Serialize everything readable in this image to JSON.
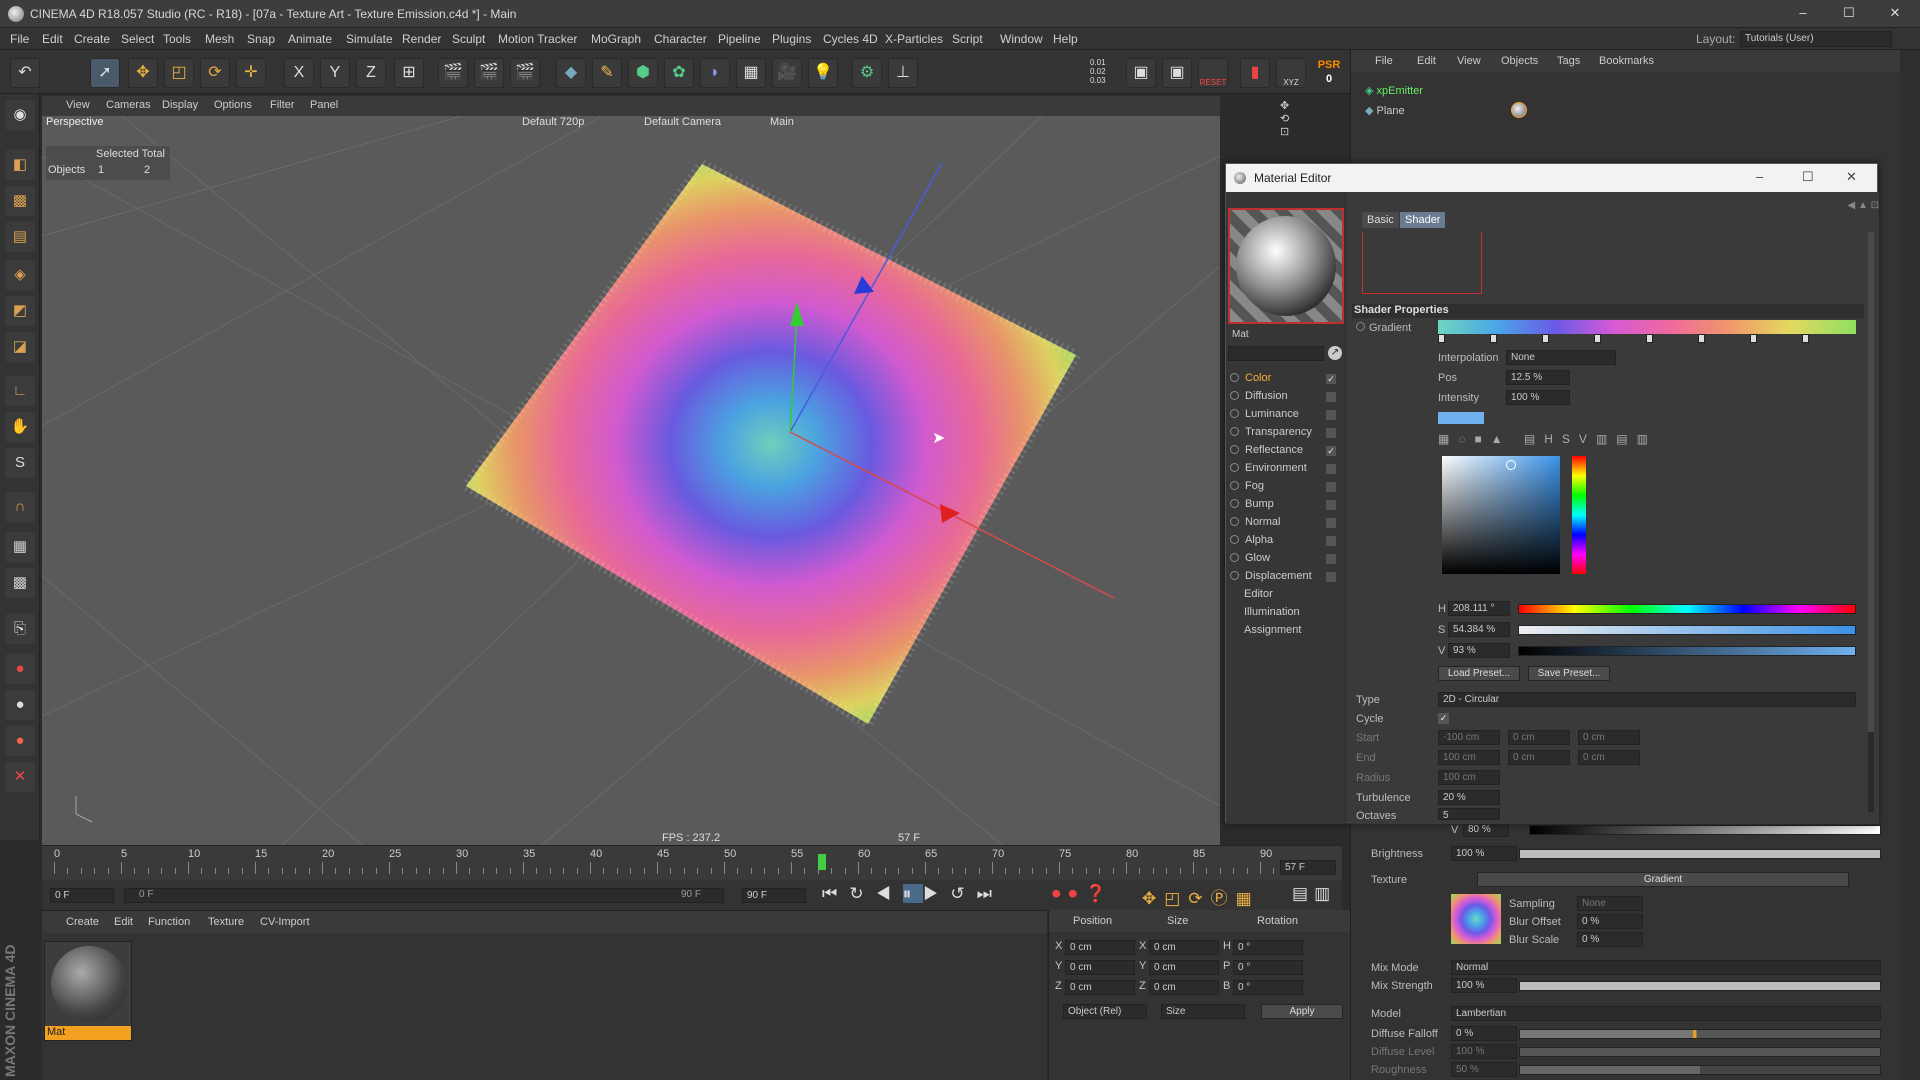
{
  "window": {
    "title": "CINEMA 4D R18.057 Studio (RC - R18) - [07a - Texture Art - Texture Emission.c4d *] - Main",
    "min": "–",
    "max": "☐",
    "close": "✕"
  },
  "menu": [
    "File",
    "Edit",
    "Create",
    "Select",
    "Tools",
    "Mesh",
    "Snap",
    "Animate",
    "Simulate",
    "Render",
    "Sculpt",
    "Motion Tracker",
    "MoGraph",
    "Character",
    "Pipeline",
    "Plugins",
    "Cycles 4D",
    "X-Particles",
    "Script",
    "Window",
    "Help"
  ],
  "layout": {
    "label": "Layout:",
    "value": "Tutorials (User)"
  },
  "toolbar": {
    "axis_x": "X",
    "axis_y": "Y",
    "axis_z": "Z",
    "reset": "RESET",
    "psr": "PSR",
    "psr_val": "0",
    "xyz": "XYZ",
    "coords": [
      "0.01",
      "0.02",
      "0.03"
    ]
  },
  "viewport": {
    "menu": [
      "View",
      "Cameras",
      "Display",
      "Options",
      "Filter",
      "Panel"
    ],
    "label": "Perspective",
    "res": "Default 720p",
    "cam": "Default Camera",
    "take": "Main",
    "fps": "FPS : 237.2",
    "frame": "57 F",
    "info": {
      "header": "Selected Total",
      "row_label": "Objects",
      "selected": "1",
      "total": "2"
    }
  },
  "timeline": {
    "ticks": [
      "0",
      "5",
      "10",
      "15",
      "20",
      "25",
      "30",
      "35",
      "40",
      "45",
      "50",
      "55",
      "60",
      "65",
      "70",
      "75",
      "80",
      "85",
      "90"
    ],
    "current": "57 F",
    "start": "0 F",
    "range_start": "0 F",
    "range_end": "90 F",
    "end": "90 F"
  },
  "materials": {
    "menu": [
      "Create",
      "Edit",
      "Function",
      "Texture",
      "CV-Import"
    ],
    "mat_name": "Mat"
  },
  "coords": {
    "headers": [
      "Position",
      "Size",
      "Rotation"
    ],
    "rows": [
      {
        "a": "X",
        "pos": "0 cm",
        "b": "X",
        "size": "0 cm",
        "c": "H",
        "rot": "0 °"
      },
      {
        "a": "Y",
        "pos": "0 cm",
        "b": "Y",
        "size": "0 cm",
        "c": "P",
        "rot": "0 °"
      },
      {
        "a": "Z",
        "pos": "0 cm",
        "b": "Z",
        "size": "0 cm",
        "c": "B",
        "rot": "0 °"
      }
    ],
    "mode": "Object (Rel)",
    "size_mode": "Size",
    "apply": "Apply"
  },
  "objmanager": {
    "menu": [
      "File",
      "Edit",
      "View",
      "Objects",
      "Tags",
      "Bookmarks"
    ],
    "objects": [
      "xpEmitter",
      "Plane"
    ]
  },
  "mateditor": {
    "title": "Material Editor",
    "mat_name": "Mat",
    "channels": [
      {
        "name": "Color",
        "checked": true,
        "active": true
      },
      {
        "name": "Diffusion",
        "checked": false
      },
      {
        "name": "Luminance",
        "checked": false
      },
      {
        "name": "Transparency",
        "checked": false
      },
      {
        "name": "Reflectance",
        "checked": true
      },
      {
        "name": "Environment",
        "checked": false
      },
      {
        "name": "Fog",
        "checked": false
      },
      {
        "name": "Bump",
        "checked": false
      },
      {
        "name": "Normal",
        "checked": false
      },
      {
        "name": "Alpha",
        "checked": false
      },
      {
        "name": "Glow",
        "checked": false
      },
      {
        "name": "Displacement",
        "checked": false
      },
      {
        "name": "Editor"
      },
      {
        "name": "Illumination"
      },
      {
        "name": "Assignment"
      }
    ],
    "tabs": [
      "Basic",
      "Shader"
    ],
    "section": "Shader Properties",
    "gradient_label": "Gradient",
    "interpolation_label": "Interpolation",
    "interpolation": "None",
    "pos_label": "Pos",
    "pos": "12.5 %",
    "intensity_label": "Intensity",
    "intensity": "100 %",
    "h_label": "H",
    "h": "208.111 °",
    "s_label": "S",
    "s": "54.384 %",
    "v_label": "V",
    "v": "93 %",
    "load_preset": "Load Preset...",
    "save_preset": "Save Preset...",
    "type_label": "Type",
    "type": "2D - Circular",
    "cycle_label": "Cycle",
    "start_label": "Start",
    "start": [
      "-100 cm",
      "0 cm",
      "0 cm"
    ],
    "end_label": "End",
    "end": [
      "100 cm",
      "0 cm",
      "0 cm"
    ],
    "radius_label": "Radius",
    "radius": "100 cm",
    "turb_label": "Turbulence",
    "turb": "20 %",
    "oct_label": "Octaves",
    "oct": "5"
  },
  "attr": {
    "v_label": "V",
    "v": "80 %",
    "brightness_label": "Brightness",
    "brightness": "100 %",
    "texture_label": "Texture",
    "texture": "Gradient",
    "sampling_label": "Sampling",
    "sampling": "None",
    "blur_offset_label": "Blur Offset",
    "blur_offset": "0 %",
    "blur_scale_label": "Blur Scale",
    "blur_scale": "0 %",
    "mixmode_label": "Mix Mode",
    "mixmode": "Normal",
    "mixstrength_label": "Mix Strength",
    "mixstrength": "100 %",
    "model_label": "Model",
    "model": "Lambertian",
    "falloff_label": "Diffuse Falloff",
    "falloff": "0 %",
    "level_label": "Diffuse Level",
    "level": "100 %",
    "rough_label": "Roughness",
    "rough": "50 %"
  },
  "maxon": "MAXON CINEMA 4D"
}
